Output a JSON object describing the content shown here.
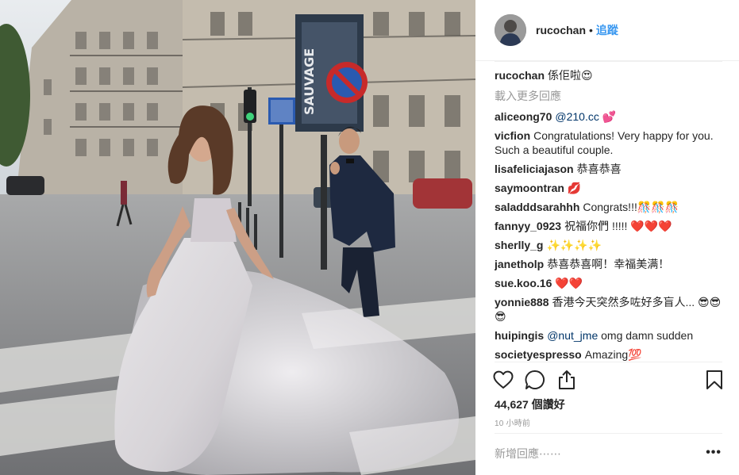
{
  "post": {
    "username": "rucochan",
    "separator": "•",
    "follow_label": "追蹤",
    "caption_user": "rucochan",
    "caption_text": "係佢啦😍",
    "load_more": "載入更多回應",
    "likes": "44,627 個讚好",
    "time": "10 小時前",
    "add_comment_placeholder": "新增回應⋯⋯",
    "more_options": "•••"
  },
  "comments": [
    {
      "user": "aliceong70",
      "mention": "@210.cc",
      "text": " 💕"
    },
    {
      "user": "vicfion",
      "mention": "",
      "text": "Congratulations! Very happy for you. Such a beautiful couple."
    },
    {
      "user": "lisafeliciajason",
      "mention": "",
      "text": "恭喜恭喜"
    },
    {
      "user": "saymoontran",
      "mention": "",
      "text": "💋"
    },
    {
      "user": "saladddsarahhh",
      "mention": "",
      "text": "Congrats!!!🎊🎊🎊"
    },
    {
      "user": "fannyy_0923",
      "mention": "",
      "text": "祝福你們 !!!!! ❤️❤️❤️"
    },
    {
      "user": "sherlly_g",
      "mention": "",
      "text": "✨✨✨✨"
    },
    {
      "user": "janetholp",
      "mention": "",
      "text": "恭喜恭喜啊！幸福美满！"
    },
    {
      "user": "sue.koo.16",
      "mention": "",
      "text": "❤️❤️"
    },
    {
      "user": "yonnie888",
      "mention": "",
      "text": "香港今天突然多咗好多盲人... 😎😎😎"
    },
    {
      "user": "huipingis",
      "mention": "@nut_jme",
      "text": " omg damn sudden"
    },
    {
      "user": "societyespresso",
      "mention": "",
      "text": "Amazing💯"
    }
  ],
  "photo": {
    "sign_text": "SAUVAGE"
  },
  "icons": {
    "like": "heart-icon",
    "comment": "comment-icon",
    "share": "share-icon",
    "save": "bookmark-icon"
  },
  "colors": {
    "link": "#3897f0",
    "mention": "#003569",
    "muted": "#999999"
  }
}
